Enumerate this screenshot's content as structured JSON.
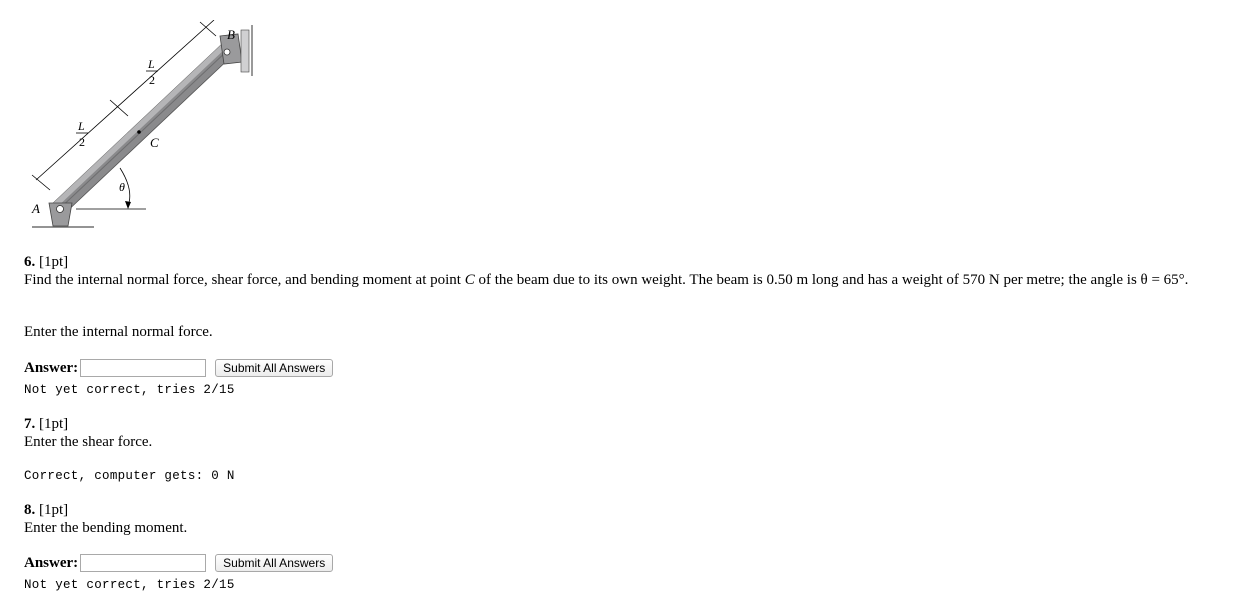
{
  "figure": {
    "labels": {
      "A": "A",
      "B": "B",
      "C": "C",
      "theta": "θ",
      "half_num_1": "L",
      "half_den_1": "2",
      "half_num_2": "L",
      "half_den_2": "2"
    }
  },
  "q6": {
    "number": "6.",
    "points": "[1pt]",
    "text_before": "Find the internal normal force, shear force, and bending moment at point ",
    "point": "C",
    "text_after": " of the beam due to its own weight. The beam is 0.50 m long and has a weight of 570 N per metre; the angle is θ = 65°.",
    "prompt": "Enter the internal normal force.",
    "answer_label": "Answer:",
    "answer_value": "",
    "submit_label": "Submit All Answers",
    "status": "Not yet correct, tries 2/15"
  },
  "q7": {
    "number": "7.",
    "points": "[1pt]",
    "prompt": "Enter the shear force.",
    "status": "Correct, computer gets: 0 N"
  },
  "q8": {
    "number": "8.",
    "points": "[1pt]",
    "prompt": "Enter the bending moment.",
    "answer_label": "Answer:",
    "answer_value": "",
    "submit_label": "Submit All Answers",
    "status": "Not yet correct, tries 2/15"
  }
}
